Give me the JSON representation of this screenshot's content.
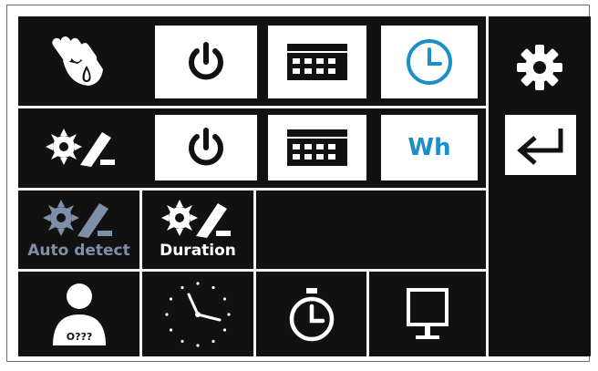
{
  "panel": {
    "wh_label": "Wh",
    "auto_detect_label": "Auto detect",
    "duration_label": "Duration",
    "user_badge": "O???"
  },
  "colors": {
    "background": "#111111",
    "tile": "#ffffff",
    "accent_blue": "#1b8fc9",
    "disabled": "#7f8fa8"
  },
  "icons": [
    "manual-water-hand-icon",
    "power-icon",
    "calendar-grid-icon",
    "clock-timer-icon",
    "settings-gear-icon",
    "sprinkler-icon",
    "power-icon",
    "calendar-grid-icon",
    "return-enter-icon",
    "sprinkler-auto-detect-icon",
    "sprinkler-duration-icon",
    "user-unknown-icon",
    "analog-clock-icon",
    "stopwatch-icon",
    "monitor-icon"
  ]
}
